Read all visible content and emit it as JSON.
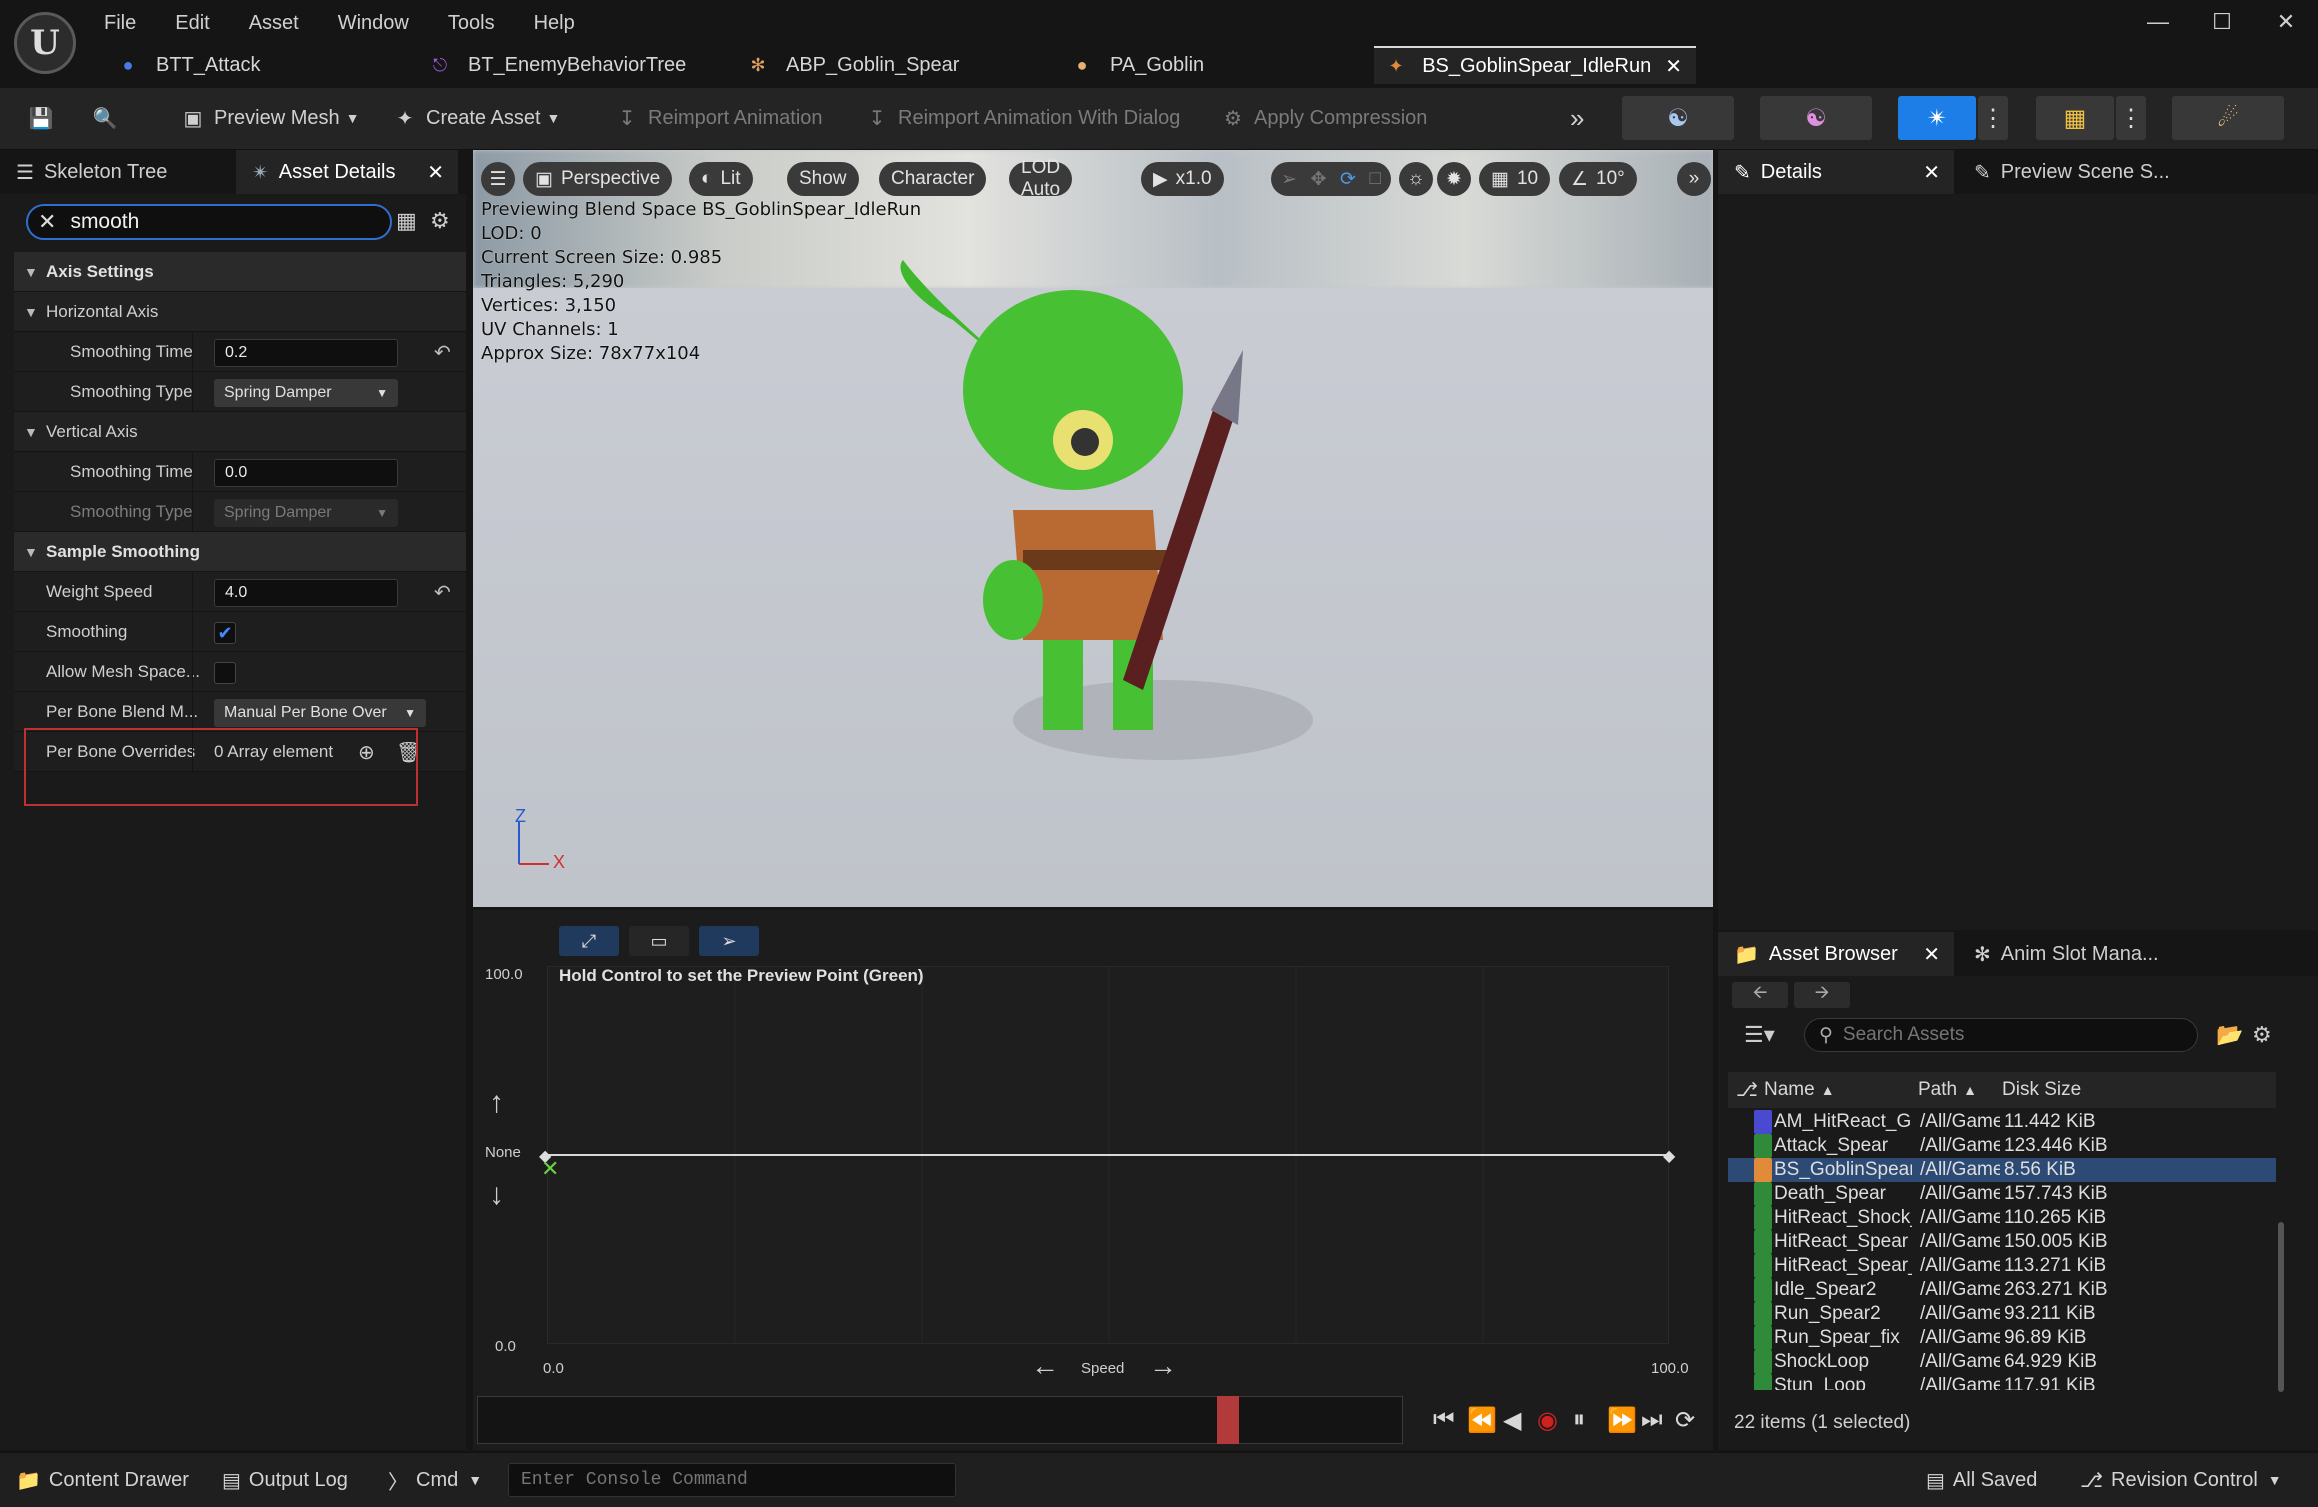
{
  "menu": [
    "File",
    "Edit",
    "Asset",
    "Window",
    "Tools",
    "Help"
  ],
  "doc_tabs": [
    {
      "label": "BTT_Attack",
      "icon": "behavior-task-icon"
    },
    {
      "label": "BT_EnemyBehaviorTree",
      "icon": "behavior-tree-icon"
    },
    {
      "label": "ABP_Goblin_Spear",
      "icon": "anim-blueprint-icon"
    },
    {
      "label": "PA_Goblin",
      "icon": "physics-asset-icon"
    },
    {
      "label": "BS_GoblinSpear_IdleRun",
      "icon": "blendspace-icon",
      "active": true
    }
  ],
  "toolbar": {
    "preview_mesh": "Preview Mesh",
    "create_asset": "Create Asset",
    "reimport": "Reimport Animation",
    "reimport_dialog": "Reimport Animation With Dialog",
    "apply_compression": "Apply Compression"
  },
  "left_panel": {
    "tab_skeleton": "Skeleton Tree",
    "tab_details": "Asset Details",
    "search_value": "smooth",
    "categories": {
      "axis_settings": "Axis Settings",
      "horizontal_axis": "Horizontal Axis",
      "vertical_axis": "Vertical Axis",
      "sample_smoothing": "Sample Smoothing"
    },
    "h_smoothing_time_label": "Smoothing Time",
    "h_smoothing_time_value": "0.2",
    "h_smoothing_type_label": "Smoothing Type",
    "h_smoothing_type_value": "Spring Damper",
    "v_smoothing_time_label": "Smoothing Time",
    "v_smoothing_time_value": "0.0",
    "v_smoothing_type_label": "Smoothing Type",
    "v_smoothing_type_value": "Spring Damper",
    "weight_speed_label": "Weight Speed",
    "weight_speed_value": "4.0",
    "smoothing_label": "Smoothing",
    "smoothing_checked": true,
    "allow_mesh_space_label": "Allow Mesh Space...",
    "allow_mesh_space_checked": false,
    "per_bone_blend_label": "Per Bone Blend M...",
    "per_bone_blend_value": "Manual Per Bone Over",
    "per_bone_overrides_label": "Per Bone Overrides",
    "per_bone_overrides_value": "0 Array element"
  },
  "viewport": {
    "perspective": "Perspective",
    "lit": "Lit",
    "show": "Show",
    "character": "Character",
    "lod": "LOD Auto",
    "speed": "x1.0",
    "grid_snap": "10",
    "angle_snap": "10°",
    "overlay": [
      "Previewing Blend Space BS_GoblinSpear_IdleRun",
      "LOD: 0",
      "Current Screen Size: 0.985",
      "Triangles: 5,290",
      "Vertices: 3,150",
      "UV Channels: 1",
      "Approx Size: 78x77x104"
    ],
    "axis_z": "Z",
    "axis_x": "X"
  },
  "blendspace": {
    "hint": "Hold Control to set the Preview Point (Green)",
    "y_max": "100.0",
    "y_min": "0.0",
    "y_label": "None",
    "x_min": "0.0",
    "x_max": "100.0",
    "x_label": "Speed"
  },
  "details_panel": {
    "tab_details": "Details",
    "tab_preview": "Preview Scene S..."
  },
  "asset_browser": {
    "tab_label": "Asset Browser",
    "tab_anim_slot": "Anim Slot Mana...",
    "search_placeholder": "Search Assets",
    "col_name": "Name",
    "col_path": "Path",
    "col_size": "Disk Size",
    "rows": [
      {
        "name": "AM_HitReact_GoblinS",
        "path": "/All/Game/A",
        "size": "11.442 KiB",
        "type": "montage"
      },
      {
        "name": "Attack_Spear",
        "path": "/All/Game/A",
        "size": "123.446 KiB",
        "type": "sequence"
      },
      {
        "name": "BS_GoblinSpear_IdleR",
        "path": "/All/Game/A",
        "size": "8.56 KiB",
        "type": "blendspace",
        "selected": true
      },
      {
        "name": "Death_Spear",
        "path": "/All/Game/A",
        "size": "157.743 KiB",
        "type": "sequence"
      },
      {
        "name": "HitReact_Shock_Loop",
        "path": "/All/Game/A",
        "size": "110.265 KiB",
        "type": "sequence"
      },
      {
        "name": "HitReact_Spear",
        "path": "/All/Game/A",
        "size": "150.005 KiB",
        "type": "sequence"
      },
      {
        "name": "HitReact_Spear_cut",
        "path": "/All/Game/A",
        "size": "113.271 KiB",
        "type": "sequence"
      },
      {
        "name": "Idle_Spear2",
        "path": "/All/Game/A",
        "size": "263.271 KiB",
        "type": "sequence"
      },
      {
        "name": "Run_Spear2",
        "path": "/All/Game/A",
        "size": "93.211 KiB",
        "type": "sequence"
      },
      {
        "name": "Run_Spear_fix",
        "path": "/All/Game/A",
        "size": "96.89 KiB",
        "type": "sequence"
      },
      {
        "name": "ShockLoop",
        "path": "/All/Game/A",
        "size": "64.929 KiB",
        "type": "sequence"
      },
      {
        "name": "Stun_Loop",
        "path": "/All/Game/A",
        "size": "117.91 KiB",
        "type": "sequence"
      }
    ],
    "footer": "22 items (1 selected)"
  },
  "statusbar": {
    "content_drawer": "Content Drawer",
    "output_log": "Output Log",
    "cmd": "Cmd",
    "console_placeholder": "Enter Console Command",
    "all_saved": "All Saved",
    "revision_control": "Revision Control"
  },
  "colors": {
    "accent_blue": "#2f6fd0",
    "highlight_red": "#c03030",
    "active_mode": "#1d7ee8",
    "goblin_green": "#3fb82c",
    "blendspace_icon": "#e08a3a",
    "sequence_icon": "#2f8a3a",
    "montage_icon": "#4a4ad0"
  }
}
